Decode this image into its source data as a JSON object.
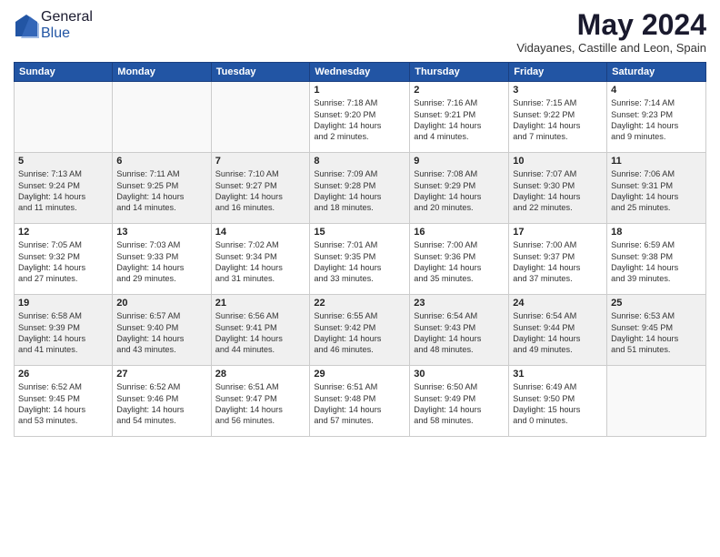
{
  "header": {
    "logo_general": "General",
    "logo_blue": "Blue",
    "month_title": "May 2024",
    "subtitle": "Vidayanes, Castille and Leon, Spain"
  },
  "days_of_week": [
    "Sunday",
    "Monday",
    "Tuesday",
    "Wednesday",
    "Thursday",
    "Friday",
    "Saturday"
  ],
  "weeks": [
    {
      "shaded": false,
      "days": [
        {
          "num": "",
          "info": ""
        },
        {
          "num": "",
          "info": ""
        },
        {
          "num": "",
          "info": ""
        },
        {
          "num": "1",
          "info": "Sunrise: 7:18 AM\nSunset: 9:20 PM\nDaylight: 14 hours\nand 2 minutes."
        },
        {
          "num": "2",
          "info": "Sunrise: 7:16 AM\nSunset: 9:21 PM\nDaylight: 14 hours\nand 4 minutes."
        },
        {
          "num": "3",
          "info": "Sunrise: 7:15 AM\nSunset: 9:22 PM\nDaylight: 14 hours\nand 7 minutes."
        },
        {
          "num": "4",
          "info": "Sunrise: 7:14 AM\nSunset: 9:23 PM\nDaylight: 14 hours\nand 9 minutes."
        }
      ]
    },
    {
      "shaded": true,
      "days": [
        {
          "num": "5",
          "info": "Sunrise: 7:13 AM\nSunset: 9:24 PM\nDaylight: 14 hours\nand 11 minutes."
        },
        {
          "num": "6",
          "info": "Sunrise: 7:11 AM\nSunset: 9:25 PM\nDaylight: 14 hours\nand 14 minutes."
        },
        {
          "num": "7",
          "info": "Sunrise: 7:10 AM\nSunset: 9:27 PM\nDaylight: 14 hours\nand 16 minutes."
        },
        {
          "num": "8",
          "info": "Sunrise: 7:09 AM\nSunset: 9:28 PM\nDaylight: 14 hours\nand 18 minutes."
        },
        {
          "num": "9",
          "info": "Sunrise: 7:08 AM\nSunset: 9:29 PM\nDaylight: 14 hours\nand 20 minutes."
        },
        {
          "num": "10",
          "info": "Sunrise: 7:07 AM\nSunset: 9:30 PM\nDaylight: 14 hours\nand 22 minutes."
        },
        {
          "num": "11",
          "info": "Sunrise: 7:06 AM\nSunset: 9:31 PM\nDaylight: 14 hours\nand 25 minutes."
        }
      ]
    },
    {
      "shaded": false,
      "days": [
        {
          "num": "12",
          "info": "Sunrise: 7:05 AM\nSunset: 9:32 PM\nDaylight: 14 hours\nand 27 minutes."
        },
        {
          "num": "13",
          "info": "Sunrise: 7:03 AM\nSunset: 9:33 PM\nDaylight: 14 hours\nand 29 minutes."
        },
        {
          "num": "14",
          "info": "Sunrise: 7:02 AM\nSunset: 9:34 PM\nDaylight: 14 hours\nand 31 minutes."
        },
        {
          "num": "15",
          "info": "Sunrise: 7:01 AM\nSunset: 9:35 PM\nDaylight: 14 hours\nand 33 minutes."
        },
        {
          "num": "16",
          "info": "Sunrise: 7:00 AM\nSunset: 9:36 PM\nDaylight: 14 hours\nand 35 minutes."
        },
        {
          "num": "17",
          "info": "Sunrise: 7:00 AM\nSunset: 9:37 PM\nDaylight: 14 hours\nand 37 minutes."
        },
        {
          "num": "18",
          "info": "Sunrise: 6:59 AM\nSunset: 9:38 PM\nDaylight: 14 hours\nand 39 minutes."
        }
      ]
    },
    {
      "shaded": true,
      "days": [
        {
          "num": "19",
          "info": "Sunrise: 6:58 AM\nSunset: 9:39 PM\nDaylight: 14 hours\nand 41 minutes."
        },
        {
          "num": "20",
          "info": "Sunrise: 6:57 AM\nSunset: 9:40 PM\nDaylight: 14 hours\nand 43 minutes."
        },
        {
          "num": "21",
          "info": "Sunrise: 6:56 AM\nSunset: 9:41 PM\nDaylight: 14 hours\nand 44 minutes."
        },
        {
          "num": "22",
          "info": "Sunrise: 6:55 AM\nSunset: 9:42 PM\nDaylight: 14 hours\nand 46 minutes."
        },
        {
          "num": "23",
          "info": "Sunrise: 6:54 AM\nSunset: 9:43 PM\nDaylight: 14 hours\nand 48 minutes."
        },
        {
          "num": "24",
          "info": "Sunrise: 6:54 AM\nSunset: 9:44 PM\nDaylight: 14 hours\nand 49 minutes."
        },
        {
          "num": "25",
          "info": "Sunrise: 6:53 AM\nSunset: 9:45 PM\nDaylight: 14 hours\nand 51 minutes."
        }
      ]
    },
    {
      "shaded": false,
      "days": [
        {
          "num": "26",
          "info": "Sunrise: 6:52 AM\nSunset: 9:45 PM\nDaylight: 14 hours\nand 53 minutes."
        },
        {
          "num": "27",
          "info": "Sunrise: 6:52 AM\nSunset: 9:46 PM\nDaylight: 14 hours\nand 54 minutes."
        },
        {
          "num": "28",
          "info": "Sunrise: 6:51 AM\nSunset: 9:47 PM\nDaylight: 14 hours\nand 56 minutes."
        },
        {
          "num": "29",
          "info": "Sunrise: 6:51 AM\nSunset: 9:48 PM\nDaylight: 14 hours\nand 57 minutes."
        },
        {
          "num": "30",
          "info": "Sunrise: 6:50 AM\nSunset: 9:49 PM\nDaylight: 14 hours\nand 58 minutes."
        },
        {
          "num": "31",
          "info": "Sunrise: 6:49 AM\nSunset: 9:50 PM\nDaylight: 15 hours\nand 0 minutes."
        },
        {
          "num": "",
          "info": ""
        }
      ]
    }
  ]
}
